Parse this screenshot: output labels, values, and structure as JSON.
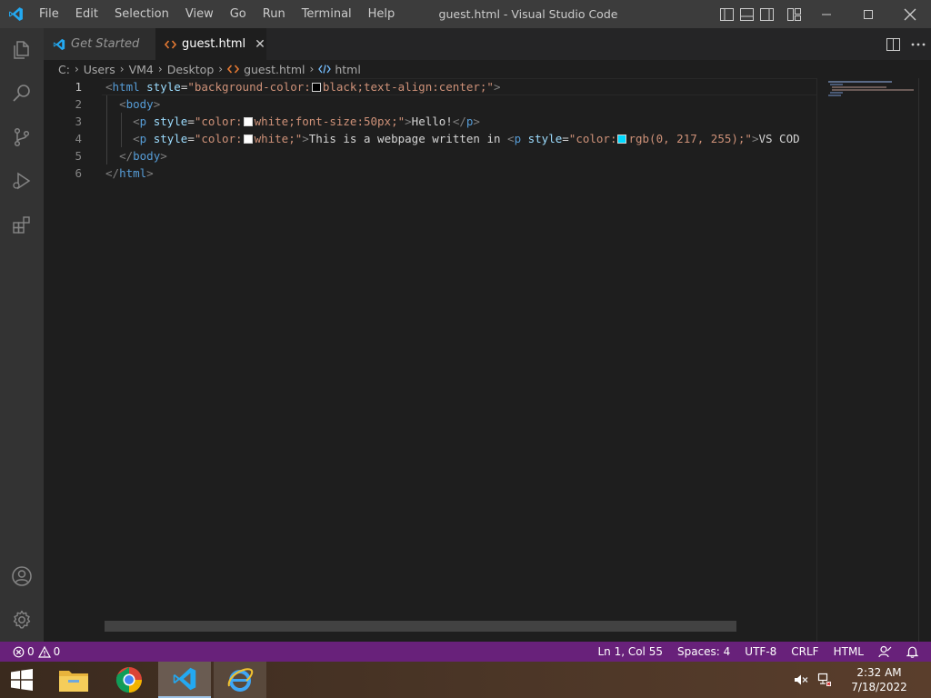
{
  "window": {
    "title": "guest.html - Visual Studio Code"
  },
  "menu": [
    "File",
    "Edit",
    "Selection",
    "View",
    "Go",
    "Run",
    "Terminal",
    "Help"
  ],
  "tabs": [
    {
      "label": "Get Started",
      "active": false
    },
    {
      "label": "guest.html",
      "active": true
    }
  ],
  "breadcrumb": {
    "segments": [
      "C:",
      "Users",
      "VM4",
      "Desktop",
      "guest.html",
      "html"
    ]
  },
  "editor": {
    "line_numbers": [
      "1",
      "2",
      "3",
      "4",
      "5",
      "6"
    ],
    "current_line": 1,
    "swatch_colors": {
      "black": "#000000",
      "white": "#ffffff",
      "cyan": "#00d9ff"
    },
    "tokens": {
      "l1_open": "<",
      "l1_tag": "html",
      "l1_attr": "style",
      "l1_eq": "=",
      "l1_q1": "\"background-color:",
      "l1_val": "black;text-align:center;\"",
      "l1_close": ">",
      "l2_open": "<",
      "l2_tag": "body",
      "l2_close": ">",
      "l3_open": "<",
      "l3_tag": "p",
      "l3_attr": "style",
      "l3_eq": "=",
      "l3_q1": "\"color:",
      "l3_val": "white;font-size:50px;\"",
      "l3_close": ">",
      "l3_text": "Hello!",
      "l3_end_open": "</",
      "l3_end_tag": "p",
      "l3_end_close": ">",
      "l4_open": "<",
      "l4_tag": "p",
      "l4_attr": "style",
      "l4_eq": "=",
      "l4_q1": "\"color:",
      "l4_val": "white;\"",
      "l4_close": ">",
      "l4_text": "This is a webpage written in ",
      "l4_open2": "<",
      "l4_tag2": "p",
      "l4_attr2": "style",
      "l4_eq2": "=",
      "l4_q2": "\"color:",
      "l4_val2": "rgb(0, 217, 255);\"",
      "l4_close2": ">",
      "l4_text2": "VS COD",
      "l5_open": "</",
      "l5_tag": "body",
      "l5_close": ">",
      "l6_open": "</",
      "l6_tag": "html",
      "l6_close": ">"
    }
  },
  "status": {
    "errors": "0",
    "warnings": "0",
    "position": "Ln 1, Col 55",
    "spaces": "Spaces: 4",
    "encoding": "UTF-8",
    "eol": "CRLF",
    "language": "HTML"
  },
  "taskbar": {
    "time": "2:32 AM",
    "date": "7/18/2022"
  },
  "colors": {
    "statusbar": "#68217a",
    "vscode_blue": "#23a9f2",
    "tag": "#569cd6",
    "attr": "#9cdcfe",
    "string": "#ce9178"
  }
}
